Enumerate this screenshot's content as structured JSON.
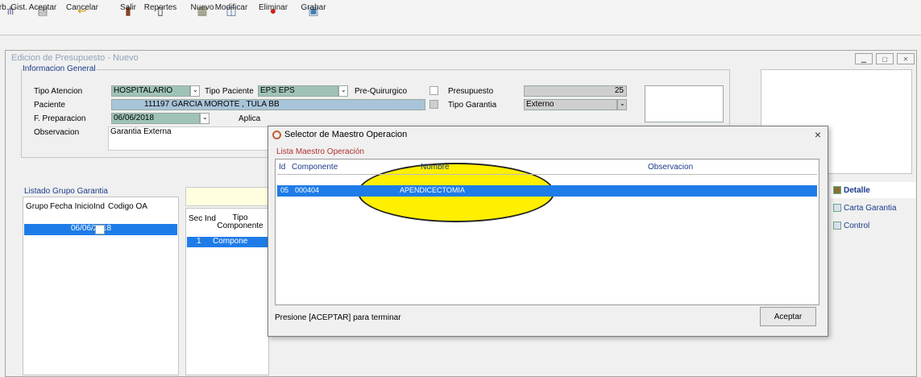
{
  "toolbar": {
    "buttons": [
      {
        "label": "Arb. Gist.",
        "icon": "tree-icon"
      },
      {
        "label": "Aceptar",
        "icon": "accept-icon"
      },
      {
        "label": "Cancelar",
        "icon": "cancel-icon"
      },
      {
        "label": "Salir",
        "icon": "exit-icon"
      },
      {
        "label": "Reportes",
        "icon": "report-icon"
      },
      {
        "label": "Nuevo",
        "icon": "new-icon"
      },
      {
        "label": "Modificar",
        "icon": "edit-icon"
      },
      {
        "label": "Eliminar",
        "icon": "delete-icon"
      },
      {
        "label": "Grabar",
        "icon": "save-icon"
      }
    ]
  },
  "window": {
    "title": "Edicion de Presupuesto - Nuevo"
  },
  "general": {
    "section_label": "Informacion General",
    "tipo_atencion_label": "Tipo Atencion",
    "tipo_atencion_value": "HOSPITALARIO",
    "tipo_paciente_label": "Tipo Paciente",
    "tipo_paciente_value": "EPS   EPS",
    "pre_quirurgico_label": "Pre-Quirurgico",
    "presupuesto_label": "Presupuesto",
    "presupuesto_value": "25",
    "paciente_label": "Paciente",
    "paciente_value": "111197 GARCIA MOROTE , TULA BB",
    "tipo_garantia_label": "Tipo Garantia",
    "tipo_garantia_value": "Externo",
    "f_preparacion_label": "F. Preparacion",
    "f_preparacion_value": "06/06/2018",
    "aplica_label": "Aplica",
    "observacion_label": "Observacion",
    "observacion_value": "Garantia Externa"
  },
  "grupo_garantia": {
    "title": "Listado Grupo Garantia",
    "headers": [
      "Grupo",
      "Fecha Inicio",
      "Ind",
      "Codigo OA"
    ],
    "row_value": "06/06/2018"
  },
  "detail_grid": {
    "headers": [
      "Sec Ind",
      "Tipo Componente"
    ],
    "row_num": "1",
    "row_value": "Compone"
  },
  "side_tabs": [
    {
      "label": "Detalle"
    },
    {
      "label": "Carta Garantia"
    },
    {
      "label": "Control"
    }
  ],
  "dialog": {
    "title": "Selector de Maestro Operacion",
    "close": "×",
    "list_caption": "Lista Maestro Operación",
    "headers": [
      "Id",
      "Componente",
      "Nombre",
      "Observacion"
    ],
    "row": {
      "id": "05",
      "componente": "000404",
      "nombre": "APENDICECTOMIA",
      "observacion": ""
    },
    "footer_text": "Presione [ACEPTAR] para terminar",
    "accept_label": "Aceptar"
  },
  "colors": {
    "highlight_blue": "#1e7ce8",
    "annotation_yellow": "#ffef00",
    "field_green": "#9fc3b6"
  }
}
